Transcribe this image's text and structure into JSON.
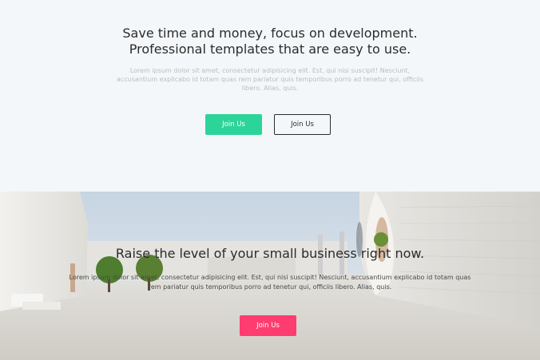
{
  "section_top": {
    "headline_line1": "Save time and money, focus on development.",
    "headline_line2": "Professional templates that are easy to use.",
    "body_text": "Lorem ipsum dolor sit amet, consectetur adipisicing elit. Est, qui nisi suscipit! Nesciunt, accusantium explicabo id totam quas rem pariatur quis temporibus porro ad tenetur qui, officiis libero. Alias, quis.",
    "primary_button_label": "Join Us",
    "secondary_button_label": "Join Us",
    "primary_button_color": "#2dd49a"
  },
  "section_bottom": {
    "title": "Raise the level of your small business right now.",
    "body_text": "Lorem ipsum dolor sit amet, consectetur adipisicing elit. Est, qui nisi suscipit! Nesciunt, accusantium explicabo id totam quas rem pariatur quis temporibus porro ad tenetur qui, officiis libero. Alias, quis.",
    "button_label": "Join Us",
    "button_color": "#ff3c6f"
  }
}
